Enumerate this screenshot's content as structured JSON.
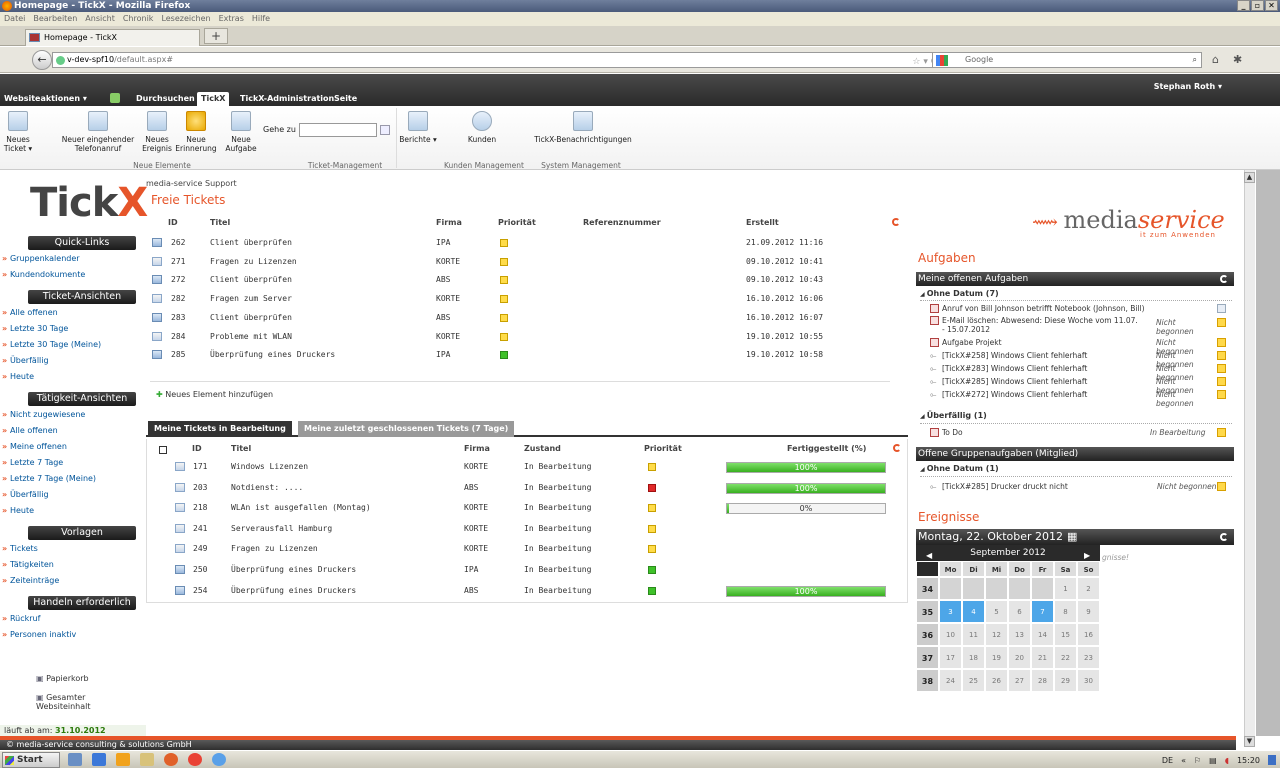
{
  "window": {
    "title": "Homepage - TickX - Mozilla Firefox"
  },
  "menu": [
    "Datei",
    "Bearbeiten",
    "Ansicht",
    "Chronik",
    "Lesezeichen",
    "Extras",
    "Hilfe"
  ],
  "browser_tab": {
    "label": "Homepage - TickX"
  },
  "url": {
    "host": "v-dev-spf10",
    "path": "/default.aspx#"
  },
  "search": {
    "placeholder": "Google"
  },
  "topnav": {
    "site_actions": "Websiteaktionen ▾",
    "tabs": [
      "Durchsuchen",
      "TickX",
      "TickX-Administration",
      "Seite"
    ],
    "active_tab": "TickX",
    "user": "Stephan Roth ▾"
  },
  "ribbon": {
    "buttons": [
      {
        "label": "Neues Ticket ▾"
      },
      {
        "label": "Neuer eingehender Telefonanruf"
      },
      {
        "label": "Neues Ereignis"
      },
      {
        "label": "Neue Erinnerung"
      },
      {
        "label": "Neue Aufgabe"
      },
      {
        "label": "Berichte ▾"
      },
      {
        "label": "Kunden"
      },
      {
        "label": "TickX-Benachrichtigungen"
      }
    ],
    "goto_label": "Gehe zu",
    "groups": [
      "Neue Elemente",
      "Ticket-Management",
      "Kunden Management",
      "System Management"
    ]
  },
  "sidebar": {
    "logo": "TickX",
    "sections": [
      {
        "title": "Quick-Links",
        "items": [
          "Gruppenkalender",
          "Kundendokumente"
        ]
      },
      {
        "title": "Ticket-Ansichten",
        "items": [
          "Alle offenen",
          "Letzte 30 Tage",
          "Letzte 30 Tage (Meine)",
          "Überfällig",
          "Heute"
        ]
      },
      {
        "title": "Tätigkeit-Ansichten",
        "items": [
          "Nicht zugewiesene",
          "Alle offenen",
          "Meine offenen",
          "Letzte 7 Tage",
          "Letzte 7 Tage (Meine)",
          "Überfällig",
          "Heute"
        ]
      },
      {
        "title": "Vorlagen",
        "items": [
          "Tickets",
          "Tätigkeiten",
          "Zeiteinträge"
        ]
      },
      {
        "title": "Handeln erforderlich",
        "items": [
          "Rückruf",
          "Personen inaktiv"
        ]
      }
    ],
    "bottom_links": [
      "Papierkorb",
      "Gesamter Websiteinhalt"
    ],
    "expires_label": "läuft ab am:",
    "expires_date": "31.10.2012"
  },
  "main": {
    "breadcrumb": "media-service Support",
    "free_tickets": {
      "title": "Freie Tickets",
      "headers": [
        "ID",
        "Titel",
        "Firma",
        "Priorität",
        "Referenznummer",
        "Erstellt"
      ],
      "rows": [
        {
          "id": "262",
          "title": "Client überprüfen",
          "firma": "IPA",
          "prio": "yellow",
          "ref": "",
          "created": "21.09.2012 11:16",
          "icon": "phone"
        },
        {
          "id": "271",
          "title": "Fragen zu Lizenzen",
          "firma": "KORTE",
          "prio": "yellow",
          "ref": "",
          "created": "09.10.2012 10:41",
          "icon": "mail"
        },
        {
          "id": "272",
          "title": "Client überprüfen",
          "firma": "ABS",
          "prio": "yellow",
          "ref": "",
          "created": "09.10.2012 10:43",
          "icon": "phone"
        },
        {
          "id": "282",
          "title": "Fragen zum Server",
          "firma": "KORTE",
          "prio": "yellow",
          "ref": "",
          "created": "16.10.2012 16:06",
          "icon": "mail"
        },
        {
          "id": "283",
          "title": "Client überprüfen",
          "firma": "ABS",
          "prio": "yellow",
          "ref": "",
          "created": "16.10.2012 16:07",
          "icon": "phone"
        },
        {
          "id": "284",
          "title": "Probleme mit WLAN",
          "firma": "KORTE",
          "prio": "yellow",
          "ref": "",
          "created": "19.10.2012 10:55",
          "icon": "mail"
        },
        {
          "id": "285",
          "title": "Überprüfung eines Druckers",
          "firma": "IPA",
          "prio": "green",
          "ref": "",
          "created": "19.10.2012 10:58",
          "icon": "phone"
        }
      ],
      "add_label": "Neues Element hinzufügen"
    },
    "my_tickets": {
      "tabs": [
        "Meine Tickets in Bearbeitung",
        "Meine zuletzt geschlossenen Tickets (7 Tage)"
      ],
      "headers": [
        "ID",
        "Titel",
        "Firma",
        "Zustand",
        "Priorität",
        "Fertiggestellt (%)"
      ],
      "rows": [
        {
          "id": "171",
          "title": "Windows Lizenzen",
          "firma": "KORTE",
          "state": "In Bearbeitung",
          "prio": "yellow",
          "progress": 100,
          "progress_label": "100%",
          "icon": "mail"
        },
        {
          "id": "203",
          "title": "Notdienst: ....",
          "firma": "ABS",
          "state": "In Bearbeitung",
          "prio": "red",
          "progress": 100,
          "progress_label": "100%",
          "icon": "mail"
        },
        {
          "id": "218",
          "title": "WLAn ist ausgefallen (Montag)",
          "firma": "KORTE",
          "state": "In Bearbeitung",
          "prio": "yellow",
          "progress": 0,
          "progress_label": "0%",
          "icon": "mail"
        },
        {
          "id": "241",
          "title": "Serverausfall Hamburg",
          "firma": "KORTE",
          "state": "In Bearbeitung",
          "prio": "yellow",
          "progress": null,
          "progress_label": "",
          "icon": "mail"
        },
        {
          "id": "249",
          "title": "Fragen zu Lizenzen",
          "firma": "KORTE",
          "state": "In Bearbeitung",
          "prio": "yellow",
          "progress": null,
          "progress_label": "",
          "icon": "mail"
        },
        {
          "id": "250",
          "title": "Überprüfung eines Druckers",
          "firma": "IPA",
          "state": "In Bearbeitung",
          "prio": "green",
          "progress": null,
          "progress_label": "",
          "icon": "phone"
        },
        {
          "id": "254",
          "title": "Überprüfung eines Druckers",
          "firma": "ABS",
          "state": "In Bearbeitung",
          "prio": "green",
          "progress": 100,
          "progress_label": "100%",
          "icon": "phone"
        }
      ]
    }
  },
  "right": {
    "logo_part1": "media",
    "logo_part2": "service",
    "logo_sub": "it zum Anwenden",
    "tasks_title": "Aufgaben",
    "my_tasks_bar": "Meine offenen Aufgaben",
    "no_date": "Ohne Datum (7)",
    "tasks": [
      {
        "text": "Anruf von Bill Johnson betrifft Notebook (Johnson, Bill)",
        "status": ""
      },
      {
        "text": "E-Mail löschen: Abwesend: Diese Woche vom 11.07. - 15.07.2012",
        "status": "Nicht begonnen"
      },
      {
        "text": "Aufgabe Projekt",
        "status": "Nicht begonnen"
      },
      {
        "text": "[TickX#258] Windows Client fehlerhaft",
        "status": "Nicht begonnen"
      },
      {
        "text": "[TickX#283] Windows Client fehlerhaft",
        "status": "Nicht begonnen"
      },
      {
        "text": "[TickX#285] Windows Client fehlerhaft",
        "status": "Nicht begonnen"
      },
      {
        "text": "[TickX#272] Windows Client fehlerhaft",
        "status": "Nicht begonnen"
      }
    ],
    "overdue": "Überfällig (1)",
    "overdue_task": {
      "text": "To Do",
      "status": "In Bearbeitung"
    },
    "group_bar": "Offene Gruppenaufgaben (Mitglied)",
    "group_no_date": "Ohne Datum (1)",
    "group_task": {
      "text": "[TickX#285] Drucker druckt nicht",
      "status": "Nicht begonnen"
    },
    "events_title": "Ereignisse",
    "events_bar": "Montag, 22. Oktober 2012",
    "events_hint": "gnisse!",
    "calendar": {
      "month": "September 2012",
      "days": [
        "Mo",
        "Di",
        "Mi",
        "Do",
        "Fr",
        "Sa",
        "So"
      ],
      "weeks": [
        {
          "wk": "34",
          "d": [
            "",
            "",
            "",
            "",
            "",
            "1",
            "2"
          ]
        },
        {
          "wk": "35",
          "d": [
            "3",
            "4",
            "5",
            "6",
            "7",
            "8",
            "9"
          ]
        },
        {
          "wk": "36",
          "d": [
            "10",
            "11",
            "12",
            "13",
            "14",
            "15",
            "16"
          ]
        },
        {
          "wk": "37",
          "d": [
            "17",
            "18",
            "19",
            "20",
            "21",
            "22",
            "23"
          ]
        },
        {
          "wk": "38",
          "d": [
            "24",
            "25",
            "26",
            "27",
            "28",
            "29",
            "30"
          ]
        }
      ],
      "selected": [
        "3",
        "4",
        "7"
      ]
    }
  },
  "footer": "© media-service consulting & solutions GmbH",
  "taskbar": {
    "start": "Start",
    "lang": "DE",
    "clock": "15:20"
  }
}
